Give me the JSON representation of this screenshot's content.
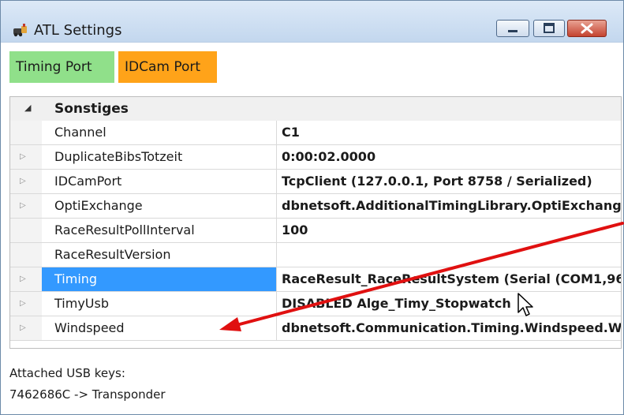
{
  "window": {
    "title": "ATL Settings",
    "icon": "atl-app-icon"
  },
  "tabs": [
    {
      "label": "Timing Port",
      "color": "#90e08a"
    },
    {
      "label": "IDCam Port",
      "color": "#ffa319"
    }
  ],
  "property_grid": {
    "category": "Sonstiges",
    "rows": [
      {
        "name": "Channel",
        "value": "C1",
        "expandable": false
      },
      {
        "name": "DuplicateBibsTotzeit",
        "value": "0:00:02.0000",
        "expandable": true
      },
      {
        "name": "IDCamPort",
        "value": "TcpClient (127.0.0.1, Port 8758 / Serialized)",
        "expandable": true
      },
      {
        "name": "OptiExchange",
        "value": "dbnetsoft.AdditionalTimingLibrary.OptiExchang",
        "expandable": true
      },
      {
        "name": "RaceResultPollInterval",
        "value": "100",
        "expandable": false
      },
      {
        "name": "RaceResultVersion",
        "value": "",
        "expandable": false
      },
      {
        "name": "Timing",
        "value": "RaceResult_RaceResultSystem (Serial (COM1,96",
        "expandable": true,
        "selected": true
      },
      {
        "name": "TimyUsb",
        "value": "DISABLED Alge_Timy_Stopwatch",
        "expandable": true
      },
      {
        "name": "Windspeed",
        "value": "dbnetsoft.Communication.Timing.Windspeed.W",
        "expandable": true
      }
    ]
  },
  "footer": {
    "line1": "Attached USB keys:",
    "line2": "7462686C -> Transponder"
  },
  "annotation": {
    "arrow_color": "#e01010"
  }
}
